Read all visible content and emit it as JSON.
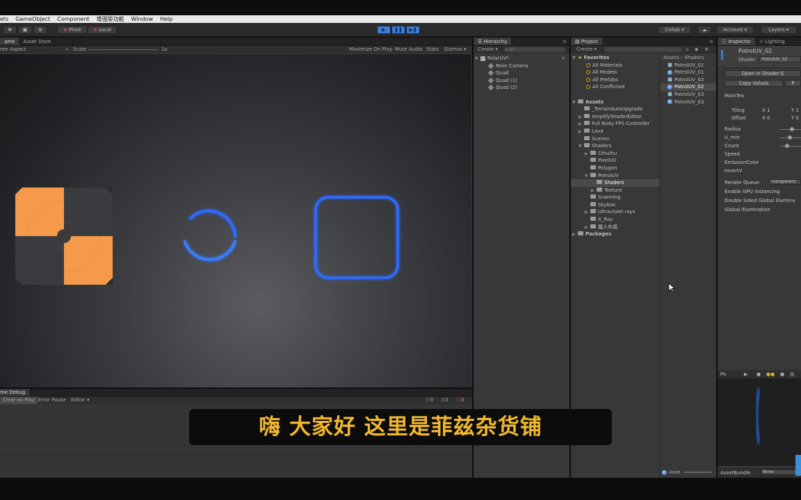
{
  "menubar": {
    "items": [
      "ets",
      "GameObject",
      "Component",
      "增强版功能",
      "Window",
      "Help"
    ]
  },
  "toolbar": {
    "pivot": "Pivot",
    "local": "Local",
    "collab": "Collab ▾",
    "account": "Account ▾",
    "layers": "Layers ▾"
  },
  "game": {
    "tabs": [
      "ame",
      "Asset Store"
    ],
    "aspect": "ree Aspect",
    "scale_label": "Scale",
    "scale_value": "1x",
    "maximize": "Maximize On Play",
    "mute": "Mute Audio",
    "stats": "Stats",
    "gizmos": "Gizmos ▾"
  },
  "console": {
    "tab": "me Debug",
    "buttons": [
      "Clear on Play",
      "Error Pause",
      "Editor ▾"
    ],
    "counts": [
      "0",
      "0",
      "0"
    ]
  },
  "hierarchy": {
    "tab": "Hierarchy",
    "create": "Create ▾",
    "search_placeholder": "All",
    "scene": "PolarUV*",
    "items": [
      "Main Camera",
      "Quad",
      "Quad (1)",
      "Quad (2)"
    ]
  },
  "project": {
    "tab": "Project",
    "create": "Create ▾",
    "favorites_label": "Favorites",
    "favorites": [
      "All Materials",
      "All Models",
      "All Prefabs",
      "All Conflicted"
    ],
    "assets_label": "Assets",
    "folders": [
      {
        "name": "_TerrainAutoUpgrade",
        "depth": 1,
        "caret": ""
      },
      {
        "name": "AmplifyShaderEditor",
        "depth": 1,
        "caret": "▶"
      },
      {
        "name": "Full Body FPS Controller",
        "depth": 1,
        "caret": "▶"
      },
      {
        "name": "Lava",
        "depth": 1,
        "caret": "▶"
      },
      {
        "name": "Scenes",
        "depth": 1,
        "caret": ""
      },
      {
        "name": "Shaders",
        "depth": 1,
        "caret": "▼"
      },
      {
        "name": "Cthulhu",
        "depth": 2,
        "caret": "▶"
      },
      {
        "name": "PixelUV",
        "depth": 2,
        "caret": ""
      },
      {
        "name": "Polygon",
        "depth": 2,
        "caret": ""
      },
      {
        "name": "PotrolUV",
        "depth": 2,
        "caret": "▼"
      },
      {
        "name": "Shaders",
        "depth": 3,
        "caret": "",
        "selected": true
      },
      {
        "name": "Texture",
        "depth": 3,
        "caret": "▶"
      },
      {
        "name": "Scanning",
        "depth": 2,
        "caret": ""
      },
      {
        "name": "Skybox",
        "depth": 2,
        "caret": ""
      },
      {
        "name": "Ultraviolet rays",
        "depth": 2,
        "caret": "▶"
      },
      {
        "name": "X_Ray",
        "depth": 2,
        "caret": ""
      },
      {
        "name": "魔人布偶",
        "depth": 2,
        "caret": "▶"
      }
    ],
    "packages_label": "Packages",
    "breadcrumb": [
      "Assets",
      "Shaders"
    ],
    "files": [
      {
        "name": "PotrolUV_01",
        "kind": "shader"
      },
      {
        "name": "PotrolUV_01",
        "kind": "material"
      },
      {
        "name": "PotrolUV_02",
        "kind": "shader"
      },
      {
        "name": "PotrolUV_02",
        "kind": "material",
        "selected": true
      },
      {
        "name": "PotrolUV_03",
        "kind": "shader"
      },
      {
        "name": "PotrolUV_03",
        "kind": "material"
      }
    ],
    "footer": "Asse"
  },
  "inspector": {
    "tabs": [
      "Inspector",
      "Lighting"
    ],
    "material_name": "PotrolUV_02",
    "shader_label": "Shader",
    "shader_value": "PotrolUV_02",
    "open_shader": "Open in Shader E",
    "copy_values": "Copy Values",
    "paste": "P",
    "maintex": "MainTex",
    "tiling_label": "Tiling",
    "tiling": {
      "x": "1",
      "y": "1"
    },
    "offset_label": "Offset",
    "offset": {
      "x": "0",
      "y": "0"
    },
    "props": [
      "Radius",
      "U_min",
      "Speed",
      "Count",
      "EmissionColor",
      "InvertV"
    ],
    "render_queue_label": "Render Queue",
    "render_queue_value": "Transparent",
    "gpu_instancing": "Enable GPU Instancing",
    "double_sided": "Double Sided Global Illumina",
    "global_illum": "Global Illumination",
    "preview_label": "Po",
    "assetbundle_label": "AssetBundle",
    "assetbundle_value": "None"
  },
  "subtitle": "嗨 大家好 这里是菲兹杂货铺",
  "colors": {
    "accent_blue": "#3d7bd8",
    "orange": "#f59a4b",
    "glow_blue": "#2f6cff",
    "subtitle_yellow": "#f2b92f"
  }
}
